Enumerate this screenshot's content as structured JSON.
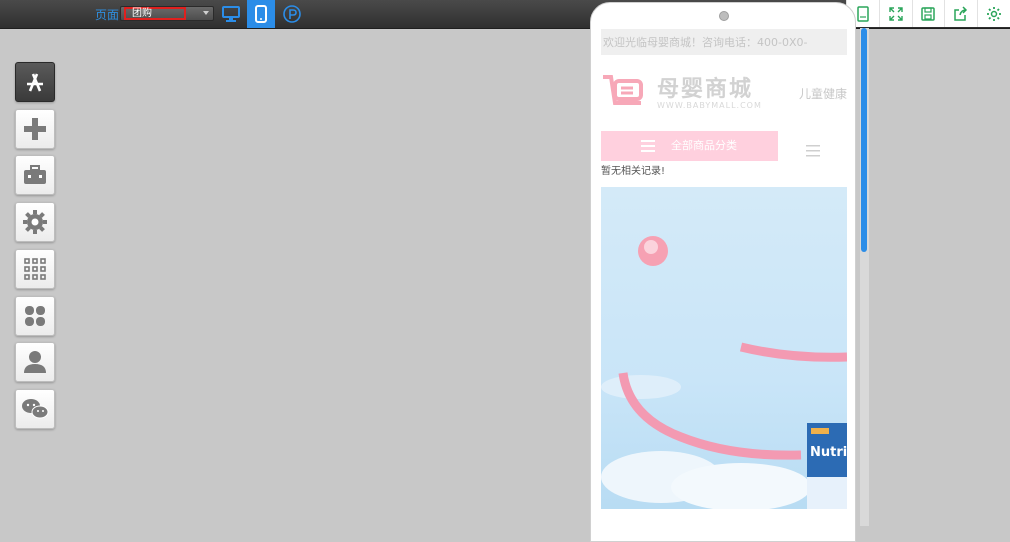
{
  "toolbar": {
    "page_label": "页面",
    "page_select_value": "团购",
    "views": [
      {
        "name": "desktop",
        "icon": "monitor-icon",
        "active": false
      },
      {
        "name": "mobile",
        "icon": "phone-icon",
        "active": true
      },
      {
        "name": "custom",
        "icon": "p-circle-icon",
        "active": false
      }
    ],
    "accent": "#2b8de8"
  },
  "right_tools": [
    {
      "icon": "mobile-frame-icon"
    },
    {
      "icon": "fullscreen-icon"
    },
    {
      "icon": "save-icon"
    },
    {
      "icon": "export-icon"
    },
    {
      "icon": "gear-icon"
    }
  ],
  "side_tools": [
    {
      "icon": "appstore-icon"
    },
    {
      "icon": "plus-icon"
    },
    {
      "icon": "toolbox-icon"
    },
    {
      "icon": "gear-icon"
    },
    {
      "icon": "grid-icon"
    },
    {
      "icon": "clover-icon"
    },
    {
      "icon": "user-icon"
    },
    {
      "icon": "wechat-icon"
    }
  ],
  "preview": {
    "welcome_text": "欢迎光临母婴商城！咨询电话：400-0X0-",
    "logo_title": "母婴商城",
    "logo_sub": "WWW.BABYMALL.COM",
    "kid_text": "儿童健康管",
    "category_button": "全部商品分类",
    "no_record": "暂无相关记录!",
    "banner_product": "Nutrilo",
    "colors": {
      "pink": "#ffd0de",
      "logo": "#f7a8b8",
      "sky": "#cfe7f8"
    }
  },
  "scroll": {
    "thumb_fraction": 0.45
  }
}
